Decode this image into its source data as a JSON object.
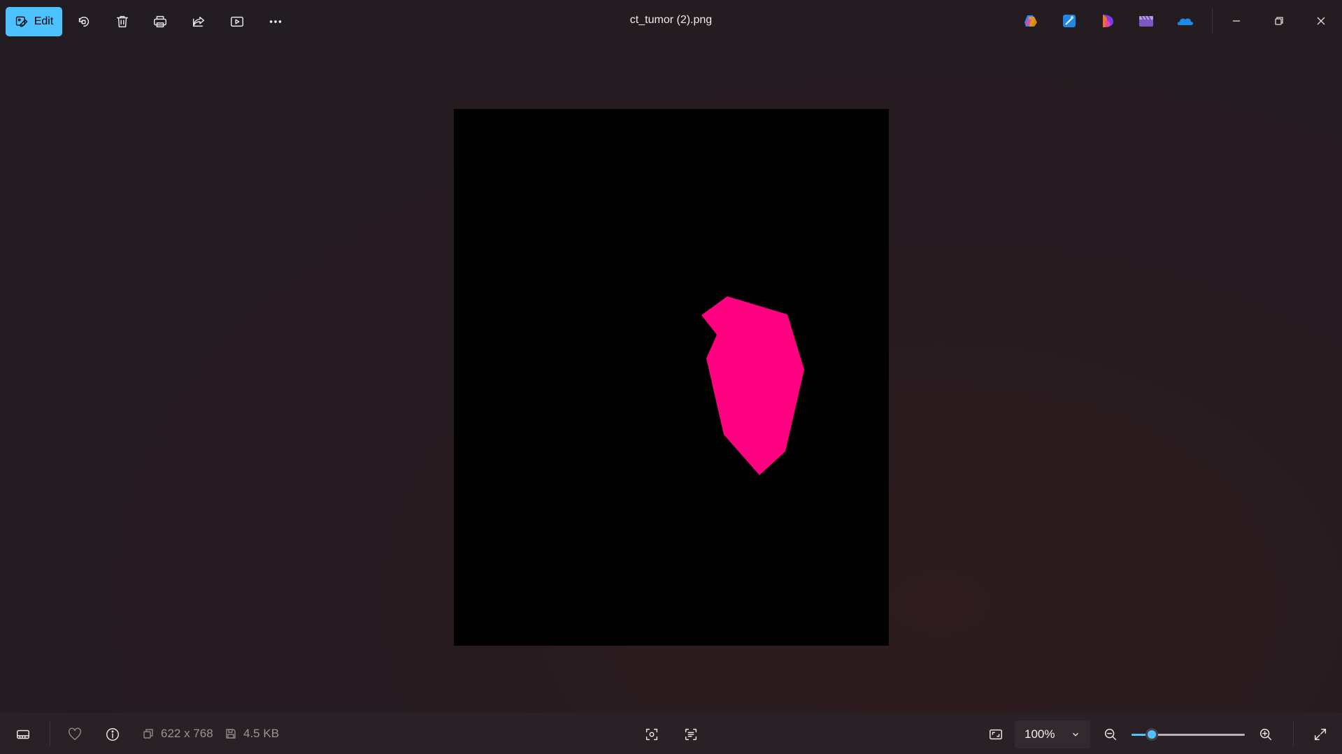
{
  "window": {
    "title": "ct_tumor (2).png"
  },
  "toolbar": {
    "edit_label": "Edit",
    "icons": [
      "rotate-icon",
      "delete-icon",
      "print-icon",
      "share-icon",
      "slideshow-icon",
      "more-icon"
    ]
  },
  "apps": [
    "copilot-icon",
    "photo-editor-icon",
    "designer-icon",
    "clipchamp-icon",
    "onedrive-icon"
  ],
  "image": {
    "background": "#000000",
    "shape_color": "#ff0080"
  },
  "statusbar": {
    "dimensions": "622 x 768",
    "file_size": "4.5 KB",
    "zoom_value": "100%",
    "zoom_level": 0.18
  },
  "colors": {
    "accent": "#4cc2ff"
  }
}
